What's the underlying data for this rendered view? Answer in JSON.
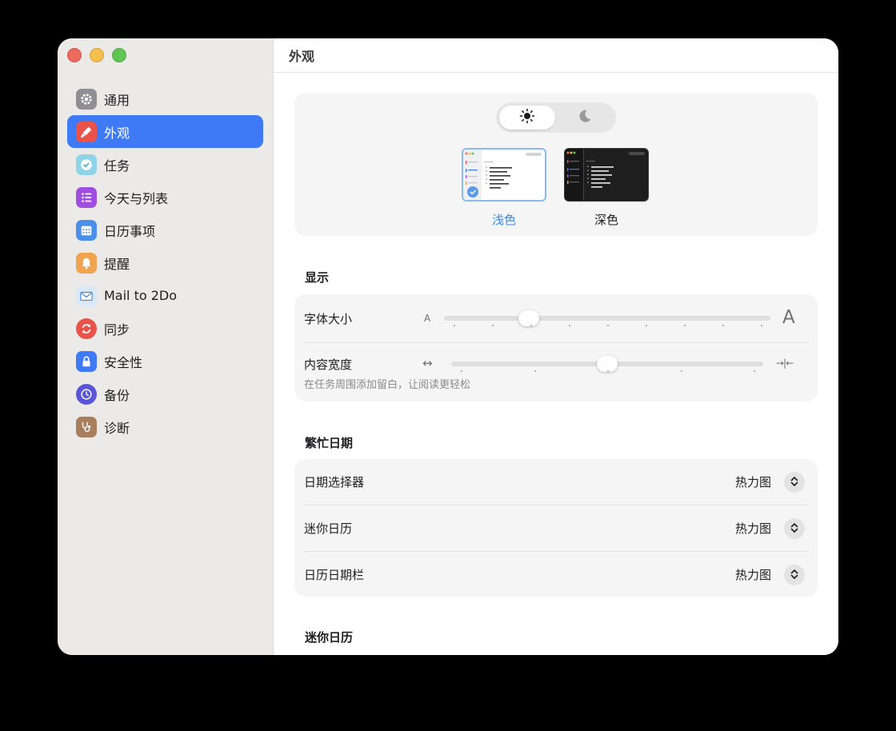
{
  "sidebar": {
    "items": [
      {
        "label": "通用",
        "icon": "gear-icon"
      },
      {
        "label": "外观",
        "icon": "paintbrush-icon"
      },
      {
        "label": "任务",
        "icon": "checkmark-icon"
      },
      {
        "label": "今天与列表",
        "icon": "list-icon"
      },
      {
        "label": "日历事项",
        "icon": "calendar-icon"
      },
      {
        "label": "提醒",
        "icon": "bell-icon"
      },
      {
        "label": "Mail to 2Do",
        "icon": "mail-icon"
      },
      {
        "label": "同步",
        "icon": "sync-icon"
      },
      {
        "label": "安全性",
        "icon": "lock-icon"
      },
      {
        "label": "备份",
        "icon": "clock-icon"
      },
      {
        "label": "诊断",
        "icon": "stethoscope-icon"
      }
    ],
    "active_index": 1
  },
  "main": {
    "title": "外观",
    "appearance": {
      "mode_selected": "light",
      "light_label": "浅色",
      "dark_label": "深色",
      "selected_theme": "light"
    },
    "display": {
      "title": "显示",
      "font_size": {
        "label": "字体大小",
        "min_glyph": "A",
        "max_glyph": "A",
        "value_fraction": 0.26
      },
      "content_width": {
        "label": "内容宽度",
        "hint": "在任务周围添加留白，让阅读更轻松",
        "min_glyph": "↔",
        "max_glyph": "→|←",
        "value_fraction": 0.5
      }
    },
    "busy_dates": {
      "title": "繁忙日期",
      "rows": [
        {
          "label": "日期选择器",
          "value": "热力图"
        },
        {
          "label": "迷你日历",
          "value": "热力图"
        },
        {
          "label": "日历日期栏",
          "value": "热力图"
        }
      ]
    },
    "mini_calendar": {
      "title": "迷你日历"
    }
  },
  "colors": {
    "accent": "#3e7af6",
    "light_theme_label": "#3b8be6",
    "sidebar_bg": "#ebeae9",
    "card_bg": "#f5f5f5"
  }
}
